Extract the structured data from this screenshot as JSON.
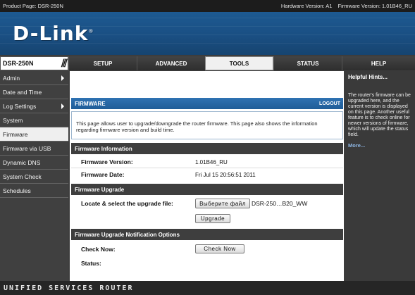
{
  "infobar": {
    "product": "Product Page: DSR-250N",
    "hardware": "Hardware Version: A1",
    "firmware": "Firmware Version: 1.01B46_RU"
  },
  "brand": {
    "logo": "D-Link",
    "reg": "®"
  },
  "nav": {
    "model": "DSR-250N",
    "tabs": [
      "SETUP",
      "ADVANCED",
      "TOOLS",
      "STATUS",
      "HELP"
    ],
    "active_tab": "TOOLS"
  },
  "sidebar": {
    "items": [
      {
        "label": "Admin",
        "arrow": true
      },
      {
        "label": "Date and Time",
        "arrow": false
      },
      {
        "label": "Log Settings",
        "arrow": true
      },
      {
        "label": "System",
        "arrow": false
      },
      {
        "label": "Firmware",
        "arrow": false,
        "active": true
      },
      {
        "label": "Firmware via USB",
        "arrow": false
      },
      {
        "label": "Dynamic DNS",
        "arrow": false
      },
      {
        "label": "System Check",
        "arrow": false
      },
      {
        "label": "Schedules",
        "arrow": false
      }
    ]
  },
  "main": {
    "title": "FIRMWARE",
    "logout": "LOGOUT",
    "description": "This page allows user to upgrade/downgrade the router firmware. This page also shows the information regarding firmware version and build time.",
    "info": {
      "title": "Firmware Information",
      "version_label": "Firmware Version:",
      "version_value": "1.01B46_RU",
      "date_label": "Firmware Date:",
      "date_value": "Fri Jul 15 20:56:51 2011"
    },
    "upgrade": {
      "title": "Firmware Upgrade",
      "locate_label": "Locate & select the upgrade file:",
      "choose_button": "Выберите файл",
      "filename": "DSR-250…B20_WW",
      "upgrade_button": "Upgrade"
    },
    "notify": {
      "title": "Firmware Upgrade Notification Options",
      "check_label": "Check Now:",
      "check_button": "Check Now",
      "status_label": "Status:"
    }
  },
  "help": {
    "title": "Helpful Hints...",
    "text": "The router's firmware can be upgraded here, and the current version is displayed on this page. Another useful feature is to check online for newer versions of firmware, which will update the status field.",
    "more": "More..."
  },
  "footer": {
    "text": "UNIFIED SERVICES ROUTER"
  },
  "colors": {
    "banner_blue": "#1a4f83",
    "header_blue": "#2f72b2",
    "dark": "#3e3e3e",
    "link": "#8fb8e6"
  }
}
